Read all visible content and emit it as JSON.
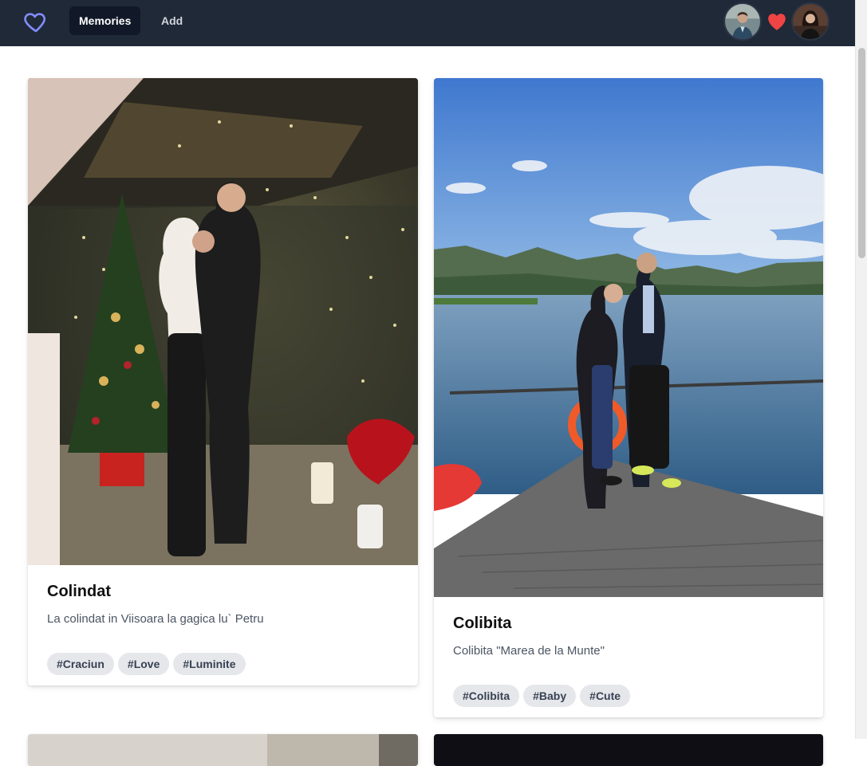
{
  "nav": {
    "logo_icon": "heart-outline-icon",
    "links": [
      {
        "label": "Memories",
        "active": true
      },
      {
        "label": "Add",
        "active": false
      }
    ],
    "couple_icon": "heart-filled-icon",
    "colors": {
      "background": "#1f2937",
      "active_link": "#111827",
      "logo": "#818cf8",
      "heart": "#ef4444"
    }
  },
  "memories": [
    {
      "title": "Colindat",
      "description": "La colindat in Viisoara la gagica lu` Petru",
      "tags": [
        "#Craciun",
        "#Love",
        "#Luminite"
      ]
    },
    {
      "title": "Colibita",
      "description": "Colibita \"Marea de la Munte\"",
      "tags": [
        "#Colibita",
        "#Baby",
        "#Cute"
      ]
    }
  ]
}
